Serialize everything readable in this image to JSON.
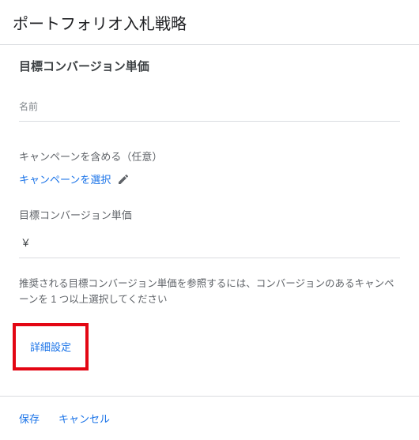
{
  "header": {
    "title": "ポートフォリオ入札戦略"
  },
  "section": {
    "title": "目標コンバージョン単価",
    "name_label": "名前",
    "include_campaign_label": "キャンペーンを含める（任意）",
    "select_campaign_link": "キャンペーンを選択",
    "target_cpa_label": "目標コンバージョン単価",
    "currency_symbol": "￥",
    "helper_text": "推奨される目標コンバージョン単価を参照するには、コンバージョンのあるキャンペーンを 1 つ以上選択してください",
    "advanced_settings": "詳細設定"
  },
  "footer": {
    "save": "保存",
    "cancel": "キャンセル"
  },
  "colors": {
    "link": "#1a73e8",
    "highlight_border": "#e30613"
  }
}
